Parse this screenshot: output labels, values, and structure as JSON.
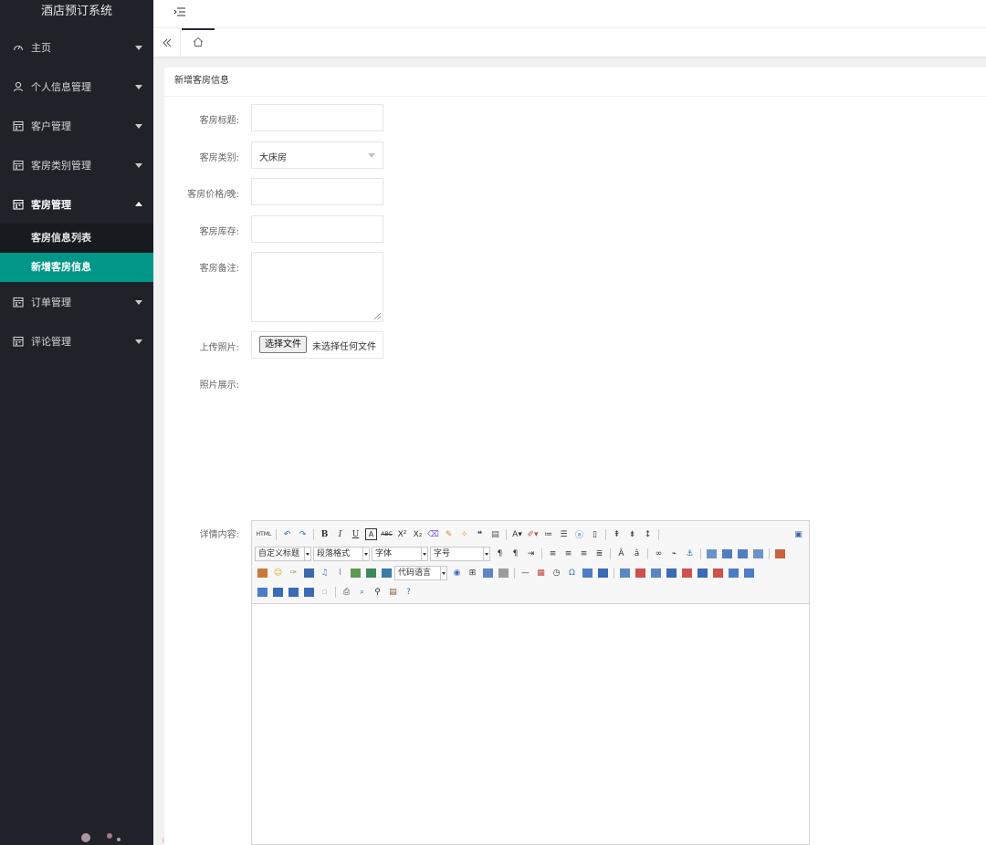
{
  "app": {
    "title": "酒店预订系统"
  },
  "sidebar": {
    "items": [
      {
        "label": "主页",
        "icon": "dashboard-icon",
        "expanded": false
      },
      {
        "label": "个人信息管理",
        "icon": "user-icon",
        "expanded": false
      },
      {
        "label": "客户管理",
        "icon": "calendar-icon",
        "expanded": false
      },
      {
        "label": "客房类别管理",
        "icon": "calendar-icon",
        "expanded": false
      },
      {
        "label": "客房管理",
        "icon": "calendar-icon",
        "expanded": true,
        "children": [
          {
            "label": "客房信息列表",
            "active": false
          },
          {
            "label": "新增客房信息",
            "active": true
          }
        ]
      },
      {
        "label": "订单管理",
        "icon": "calendar-icon",
        "expanded": false
      },
      {
        "label": "评论管理",
        "icon": "calendar-icon",
        "expanded": false
      }
    ]
  },
  "tabs": {
    "home_icon": "home-icon",
    "collapse_icon": "double-chevron-left-icon"
  },
  "form": {
    "title": "新增客房信息",
    "room_title_label": "客房标题:",
    "room_title_value": "",
    "room_type_label": "客房类别:",
    "room_type_value": "大床房",
    "price_label": "客房价格/晚:",
    "price_value": "",
    "stock_label": "客房库存:",
    "stock_value": "",
    "remark_label": "客房备注:",
    "remark_value": "",
    "upload_label": "上传照片:",
    "upload_button": "选择文件",
    "upload_status": "未选择任何文件",
    "photo_label": "照片展示:",
    "detail_label": "详情内容:"
  },
  "editor": {
    "combos": {
      "custom_heading": "自定义标题",
      "paragraph": "段落格式",
      "font_family": "字体",
      "font_size": "字号",
      "code_lang": "代码语言"
    }
  },
  "colors": {
    "sidebar_bg": "#20222a",
    "active_teal": "#009688",
    "subnav_bg": "#181a1f"
  }
}
